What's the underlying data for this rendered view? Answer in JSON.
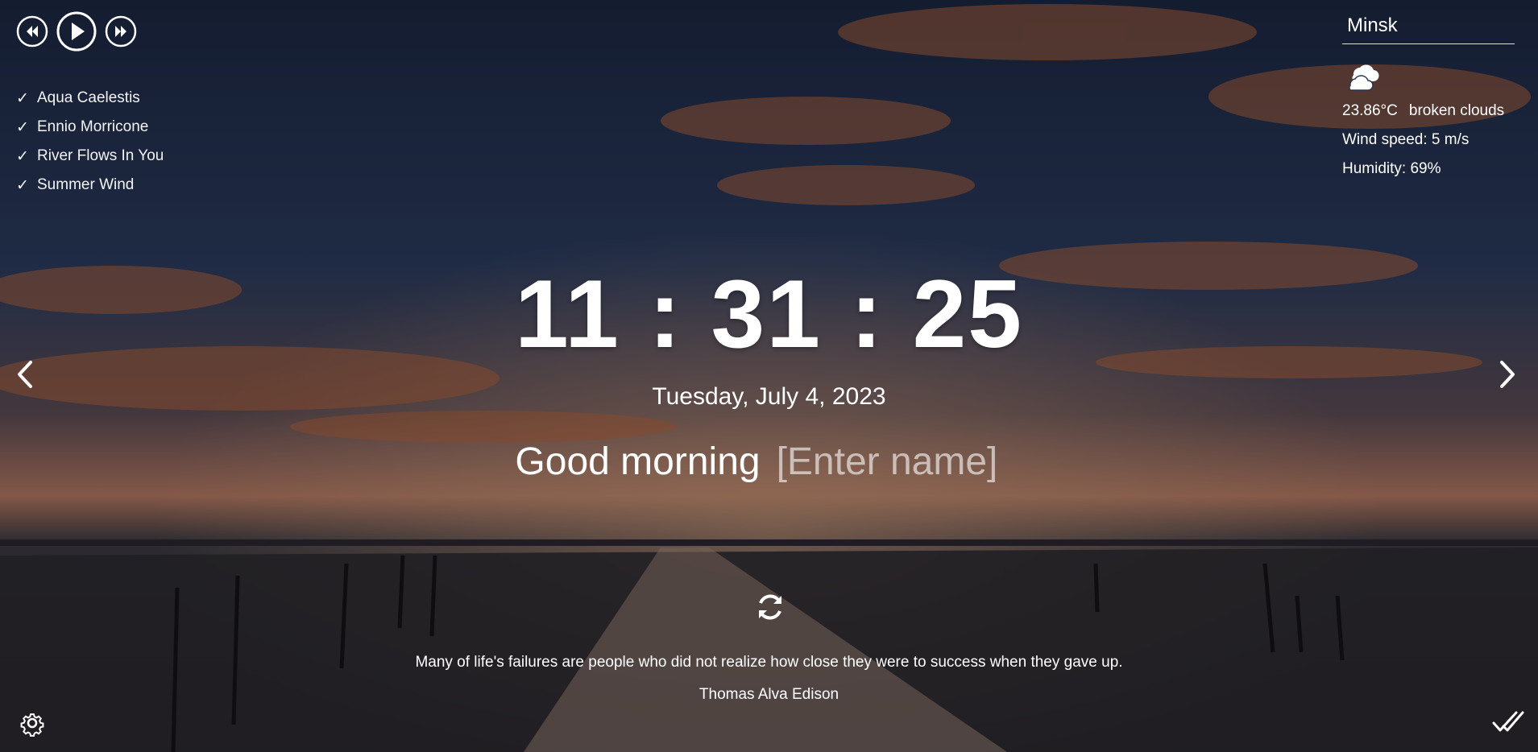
{
  "player": {
    "controls": [
      "rewind-icon",
      "play-icon",
      "fast-forward-icon"
    ],
    "tracks": [
      "Aqua Caelestis",
      "Ennio Morricone",
      "River Flows In You",
      "Summer Wind"
    ],
    "check_glyph": "✓"
  },
  "weather": {
    "city": "Minsk",
    "icon": "cloud-icon",
    "temperature": "23.86°C",
    "description": "broken clouds",
    "wind": "Wind speed: 5 m/s",
    "humidity": "Humidity: 69%"
  },
  "time": "11 : 31 : 25",
  "date": "Tuesday, July 4, 2023",
  "greeting": {
    "text": "Good morning",
    "name_placeholder": "[Enter name]"
  },
  "quote": {
    "text": "Many of life's failures are people who did not realize how close they were to success when they gave up.",
    "author": "Thomas Alva Edison"
  },
  "icons": {
    "prev_slide": "chevron-left-icon",
    "next_slide": "chevron-right-icon",
    "refresh": "refresh-icon",
    "settings": "gear-icon",
    "todo": "double-check-icon"
  }
}
